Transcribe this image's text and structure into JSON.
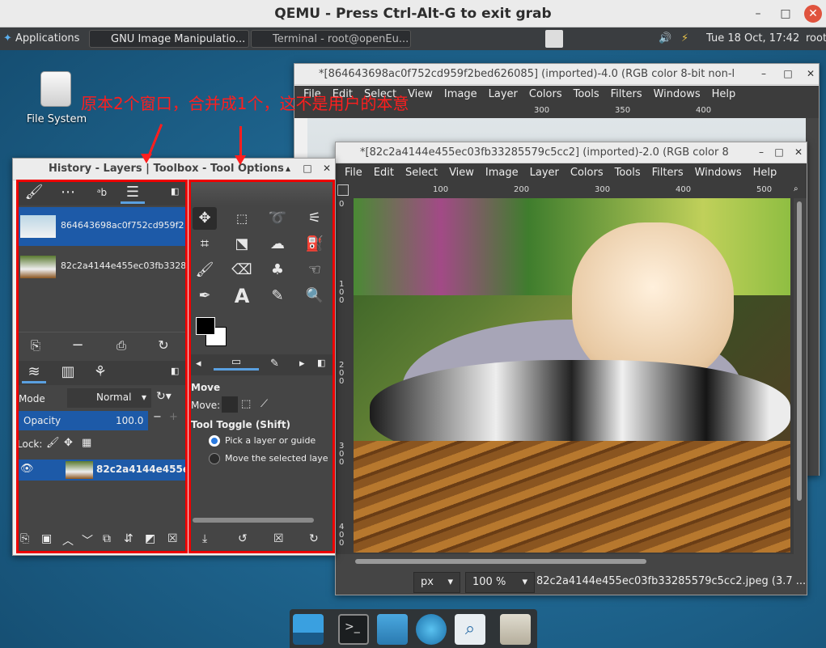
{
  "qemu": {
    "title": "QEMU - Press Ctrl-Alt-G to exit grab",
    "btn_min": "–",
    "btn_max": "□",
    "btn_close": "✕"
  },
  "panel": {
    "apps": "Applications",
    "task1": "GNU Image Manipulatio...",
    "task2": "Terminal - root@openEu...",
    "clock": "Tue 18 Oct, 17:42",
    "user": "root"
  },
  "desktop": {
    "fs_label": "File System"
  },
  "annotation": "原本2个窗口，合并成1个，这不是用户的本意",
  "back_window": {
    "title": "*[864643698ac0f752cd959f2bed626085] (imported)-4.0 (RGB color 8-bit non-l",
    "menu": [
      "File",
      "Edit",
      "Select",
      "View",
      "Image",
      "Layer",
      "Colors",
      "Tools",
      "Filters",
      "Windows",
      "Help"
    ],
    "ruler": [
      "300",
      "350",
      "400"
    ]
  },
  "front_window": {
    "title": "*[82c2a4144e455ec03fb33285579c5cc2] (imported)-2.0 (RGB color 8",
    "menu": [
      "File",
      "Edit",
      "Select",
      "View",
      "Image",
      "Layer",
      "Colors",
      "Tools",
      "Filters",
      "Windows",
      "Help"
    ],
    "ruler": [
      "100",
      "200",
      "300",
      "400",
      "500"
    ],
    "vruler": [
      "0",
      "1 0 0",
      "2 0 0",
      "3 0 0",
      "4 0 0"
    ],
    "unit": "px",
    "zoom": "100 %",
    "status": "82c2a4144e455ec03fb33285579c5cc2.jpeg (3.7 ..."
  },
  "dock_window": {
    "title": "History - Layers | Toolbox - Tool Options",
    "images": [
      {
        "name": "864643698ac0f752cd959f2"
      },
      {
        "name": "82c2a4144e455ec03fb3328"
      }
    ],
    "mode_label": "Mode",
    "mode_value": "Normal",
    "opacity_label": "Opacity",
    "opacity_value": "100.0",
    "lock_label": "Lock:",
    "layer_name": "82c2a4144e455e"
  },
  "tool_options": {
    "heading": "Move",
    "move_label": "Move:",
    "toggle_label": "Tool Toggle  (Shift)",
    "opt1": "Pick a layer or guide",
    "opt2": "Move the selected laye"
  },
  "colors": {
    "accent": "#1d5aa8",
    "annotation": "#ff1e1e",
    "dark": "#454545"
  }
}
